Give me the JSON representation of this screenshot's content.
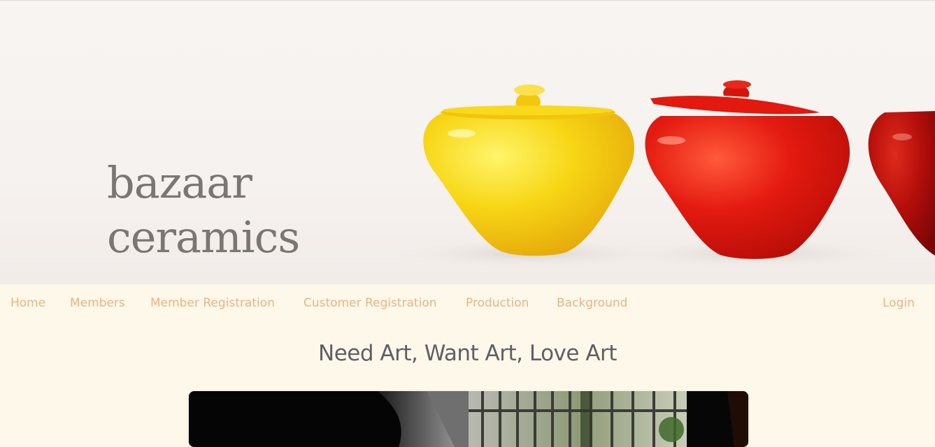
{
  "brand": {
    "line1": "bazaar",
    "line2": "ceramics"
  },
  "nav": {
    "items": [
      {
        "label": "Home"
      },
      {
        "label": "Members"
      },
      {
        "label": "Member Registration"
      },
      {
        "label": "Customer Registration"
      },
      {
        "label": "Production"
      },
      {
        "label": "Background"
      }
    ],
    "login": "Login"
  },
  "main": {
    "headline": "Need Art, Want Art, Love Art"
  },
  "colors": {
    "background": "#fdf8ea",
    "nav_link": "#e8b57f",
    "headline": "#5f5f66",
    "brand_text": "#7a7672",
    "pot_yellow": "#f6cf12",
    "pot_red": "#e3180f",
    "pot_dark_red": "#a50a0a"
  },
  "icons": {
    "hero": "ceramic-pots-image",
    "feature": "studio-photo"
  }
}
